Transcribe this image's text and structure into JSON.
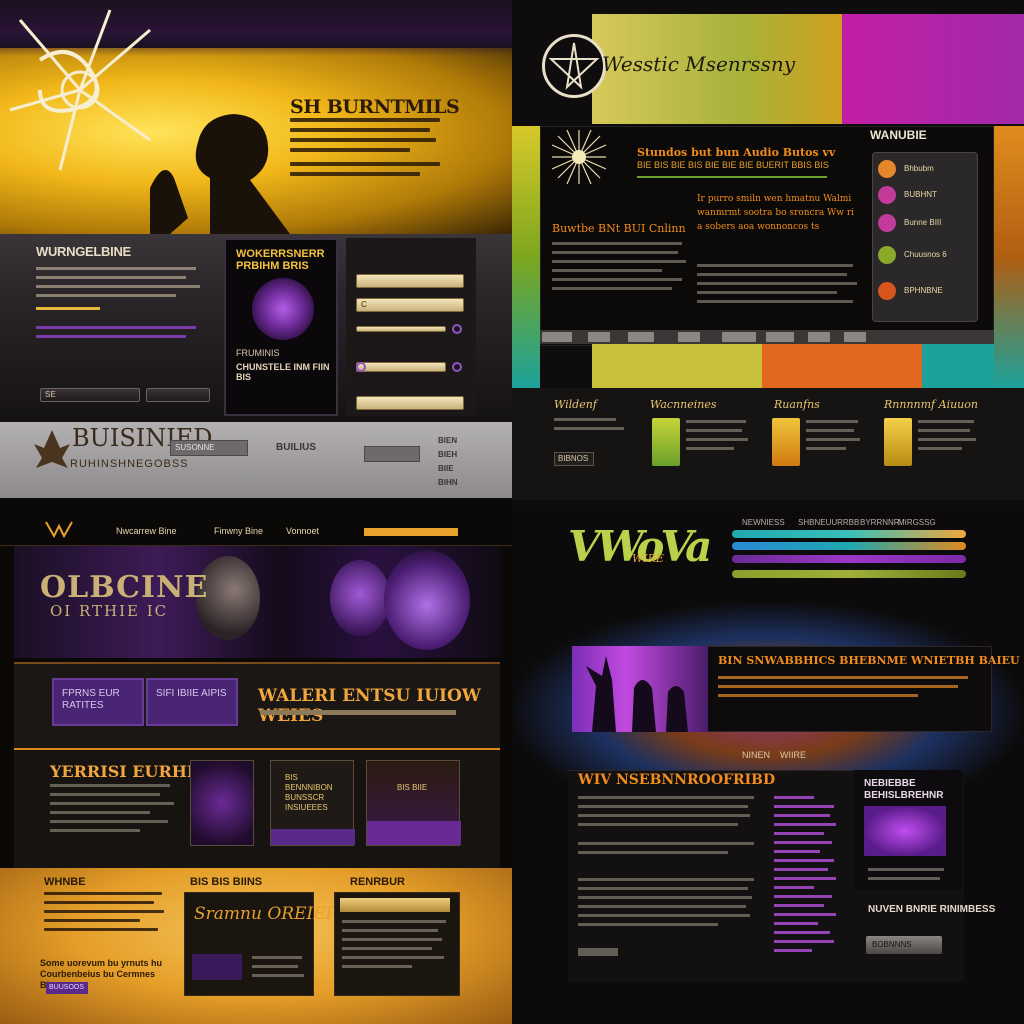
{
  "q1": {
    "hero_title": "SH BURNTMILS",
    "mid_heading": "WURNGELBINE",
    "card_heading": "WOKERRSNERR PRBIHM BRIS",
    "card_caption": "FRUMINIS",
    "card_caption2": "CHUNSTELE INM FIIN BIS",
    "btn_left": "SE",
    "btn_mid": "",
    "btn_right": "",
    "field_label_1": "S",
    "field_label_2": "C",
    "foot_logo": "BUISINIED",
    "foot_sub": "RUHINSHNEGOBSS",
    "foot_btn": "SUSONNE",
    "foot_link_1": "BUILIUS",
    "foot_link_2": "BIEN",
    "foot_link_3": "BIEH",
    "foot_link_4": "BIIE",
    "foot_link_5": "BIHN"
  },
  "q2": {
    "logo_text": "Wesstic Msenrssny",
    "headline": "Stundos but bun Audio Butos vv",
    "headline2": "BIE BIS BIE BIS BIE BIE BIE BUERIT BBIS BIS",
    "sub_left": "Buwtbe BNt BUI Cnlinn",
    "sub_right": "Ir purro smiln wen hmatnu Walmi wanmrmt sootra bo sroncra Ww ri a sobers aoa wonnoncos ts",
    "widget_title": "WANUBIE",
    "widget_items": [
      "Bhbubm",
      "BUBHNT",
      "Bunne BIII",
      "Chuusnos 6",
      "BPHNBNE"
    ],
    "low_headings": [
      "Wildenf",
      "Wacnneines",
      "Ruanfns",
      "Rnnnnmf Aiuuon"
    ],
    "low_btn": "BIBNOS"
  },
  "q3": {
    "nav_items": [
      "Nwcarrew Bine",
      "Finwny Bine",
      "Vonnoet"
    ],
    "banner_title": "OLBCINE",
    "banner_sub": "OI RTHIE IC",
    "box1": "FPRNS EUR RATITES",
    "box2": "SIFI IBIIE AIPIS",
    "row2_title": "WALERI ENTSU IUIOW WEIES",
    "row3_title": "YERRISI EURHIES",
    "tile_1_text": "BIS BENNNIBON BUNSSCR INSIUEEES",
    "tile_2_text": "BIS BIIE",
    "ob_h1": "WHNBE",
    "ob_h2": "BIS BIS BIINS",
    "ob_h3": "RENRBUR",
    "ob_script": "Sramnu OREIEPS",
    "ob_text": "Some uorevum bu yrnuts hu Courbenbeius bu Cermnes Bis",
    "ob_btn": "BUUSOOS"
  },
  "q4": {
    "logo": "VWoVa",
    "logo_sub": "WIRE",
    "nav_items": [
      "NEWNIESS",
      "SHBNEUURRBB",
      "BYRRNNR",
      "MIRGSSG"
    ],
    "stripe_colors": [
      "#1fa8b0",
      "#e08a1e",
      "#9b38c8",
      "#8aa02a"
    ],
    "hero_title": "BIN SNWABBHICS BHEBNME WNIETBH BAIEU",
    "menu_items": [
      "NINEN",
      "WIIRE"
    ],
    "content_title": "WIV NSEBNNROOFRIBD",
    "side_heading": "NEBIEBBE BEHISLBREHNR",
    "side_heading2": "NUVEN BNRIE RINIMBESS",
    "side_btn": "BOBNNNS"
  }
}
